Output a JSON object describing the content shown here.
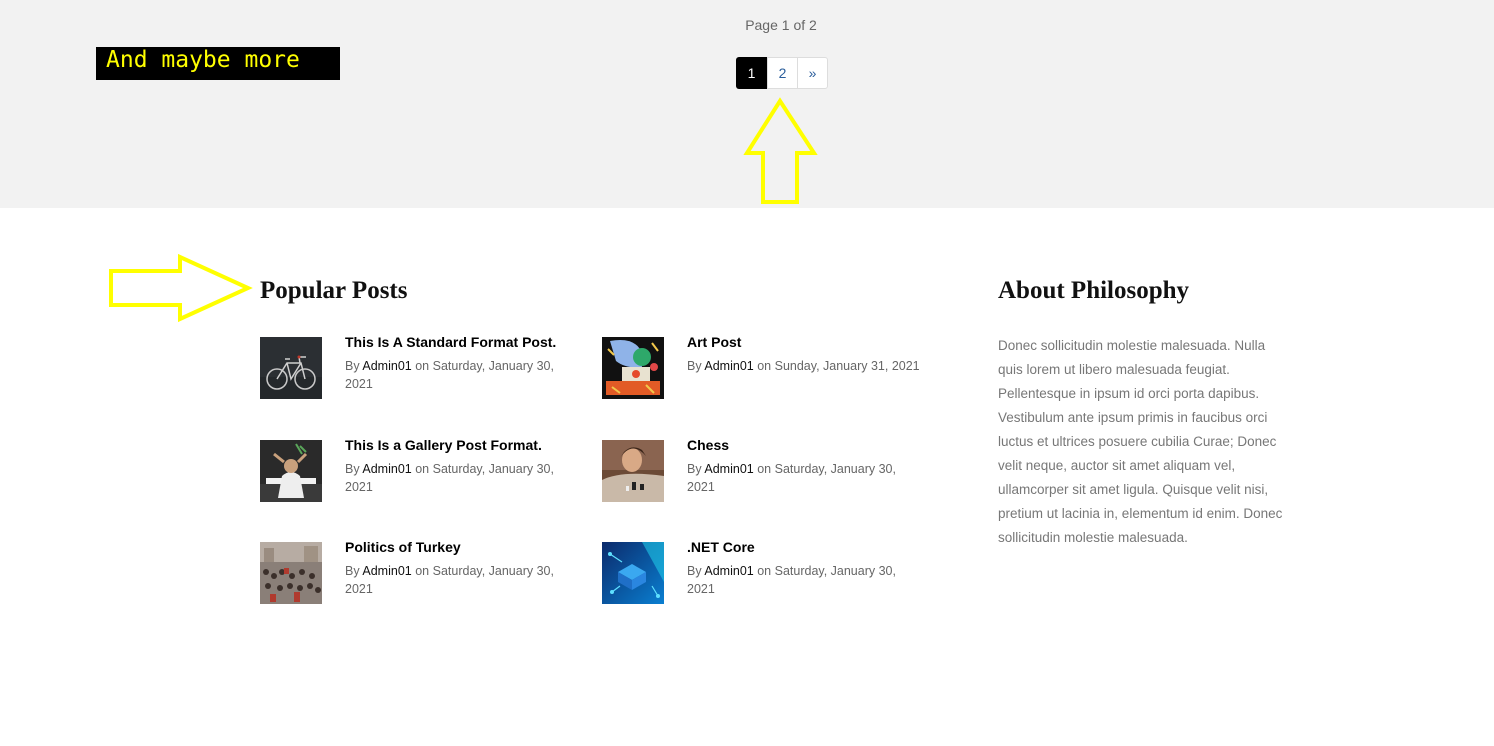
{
  "overlay": {
    "caption": "And maybe more",
    "annotation_color": "#ffff00"
  },
  "pagination": {
    "indicator": "Page 1 of 2",
    "pages": [
      "1",
      "2"
    ],
    "next": "»",
    "active_page": "1"
  },
  "popular_posts": {
    "heading": "Popular Posts",
    "by_label": "By",
    "on_label": "on",
    "posts": [
      {
        "title": "This Is A Standard Format Post.",
        "author": "Admin01",
        "date": "Saturday, January 30, 2021",
        "thumb_icon": "bicycle-image"
      },
      {
        "title": "Art Post",
        "author": "Admin01",
        "date": "Sunday, January 31, 2021",
        "thumb_icon": "colorful-art-image"
      },
      {
        "title": "This Is a Gallery Post Format.",
        "author": "Admin01",
        "date": "Saturday, January 30, 2021",
        "thumb_icon": "person-desk-image"
      },
      {
        "title": "Chess",
        "author": "Admin01",
        "date": "Saturday, January 30, 2021",
        "thumb_icon": "chess-image"
      },
      {
        "title": "Politics of Turkey",
        "author": "Admin01",
        "date": "Saturday, January 30, 2021",
        "thumb_icon": "crowd-image"
      },
      {
        "title": ".NET Core",
        "author": "Admin01",
        "date": "Saturday, January 30, 2021",
        "thumb_icon": "tech-blue-image"
      }
    ]
  },
  "about": {
    "heading": "About Philosophy",
    "text": "Donec sollicitudin molestie malesuada. Nulla quis lorem ut libero malesuada feugiat. Pellentesque in ipsum id orci porta dapibus. Vestibulum ante ipsum primis in faucibus orci luctus et ultrices posuere cubilia Curae; Donec velit neque, auctor sit amet aliquam vel, ullamcorper sit amet ligula. Quisque velit nisi, pretium ut lacinia in, elementum id enim. Donec sollicitudin molestie malesuada."
  }
}
